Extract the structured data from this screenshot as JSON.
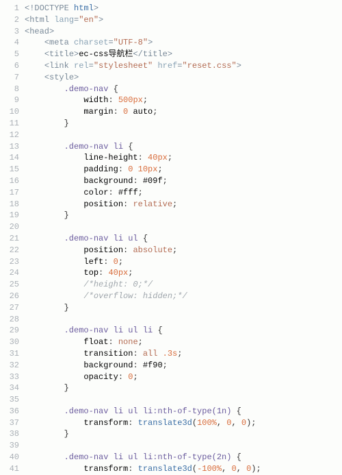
{
  "lines": [
    {
      "n": 1,
      "tokens": [
        [
          "doctype",
          "<!DOCTYPE "
        ],
        [
          "ident",
          "html"
        ],
        [
          "doctype",
          ">"
        ]
      ]
    },
    {
      "n": 2,
      "tokens": [
        [
          "punct",
          "<"
        ],
        [
          "tag",
          "html "
        ],
        [
          "attr",
          "lang"
        ],
        [
          "punct",
          "="
        ],
        [
          "str",
          "\"en\""
        ],
        [
          "punct",
          ">"
        ]
      ]
    },
    {
      "n": 3,
      "tokens": [
        [
          "punct",
          "<"
        ],
        [
          "tag",
          "head"
        ],
        [
          "punct",
          ">"
        ]
      ]
    },
    {
      "n": 4,
      "indent": "    ",
      "tokens": [
        [
          "punct",
          "<"
        ],
        [
          "tag",
          "meta "
        ],
        [
          "attr",
          "charset"
        ],
        [
          "punct",
          "="
        ],
        [
          "str",
          "\"UTF-8\""
        ],
        [
          "punct",
          ">"
        ]
      ]
    },
    {
      "n": 5,
      "indent": "    ",
      "tokens": [
        [
          "punct",
          "<"
        ],
        [
          "tag",
          "title"
        ],
        [
          "punct",
          ">"
        ],
        [
          "val",
          "ec-css导航栏"
        ],
        [
          "punct",
          "</"
        ],
        [
          "tag",
          "title"
        ],
        [
          "punct",
          ">"
        ]
      ]
    },
    {
      "n": 6,
      "indent": "    ",
      "tokens": [
        [
          "punct",
          "<"
        ],
        [
          "tag",
          "link "
        ],
        [
          "attr",
          "rel"
        ],
        [
          "punct",
          "="
        ],
        [
          "str",
          "\"stylesheet\""
        ],
        [
          "attr",
          " href"
        ],
        [
          "punct",
          "="
        ],
        [
          "str",
          "\"reset.css\""
        ],
        [
          "punct",
          ">"
        ]
      ]
    },
    {
      "n": 7,
      "indent": "    ",
      "tokens": [
        [
          "punct",
          "<"
        ],
        [
          "tag",
          "style"
        ],
        [
          "punct",
          ">"
        ]
      ]
    },
    {
      "n": 8,
      "indent": "        ",
      "tokens": [
        [
          "sel",
          ".demo-nav "
        ],
        [
          "brace",
          "{"
        ]
      ]
    },
    {
      "n": 9,
      "indent": "            ",
      "tokens": [
        [
          "prop",
          "width"
        ],
        [
          "semi",
          ": "
        ],
        [
          "num",
          "500px"
        ],
        [
          "semi",
          ";"
        ]
      ]
    },
    {
      "n": 10,
      "indent": "            ",
      "tokens": [
        [
          "prop",
          "margin"
        ],
        [
          "semi",
          ": "
        ],
        [
          "num",
          "0"
        ],
        [
          "val",
          " auto"
        ],
        [
          "semi",
          ";"
        ]
      ]
    },
    {
      "n": 11,
      "indent": "        ",
      "tokens": [
        [
          "brace",
          "}"
        ]
      ]
    },
    {
      "n": 12,
      "tokens": []
    },
    {
      "n": 13,
      "indent": "        ",
      "tokens": [
        [
          "sel",
          ".demo-nav li "
        ],
        [
          "brace",
          "{"
        ]
      ]
    },
    {
      "n": 14,
      "indent": "            ",
      "tokens": [
        [
          "prop",
          "line-height"
        ],
        [
          "semi",
          ": "
        ],
        [
          "num",
          "40px"
        ],
        [
          "semi",
          ";"
        ]
      ]
    },
    {
      "n": 15,
      "indent": "            ",
      "tokens": [
        [
          "prop",
          "padding"
        ],
        [
          "semi",
          ": "
        ],
        [
          "num",
          "0"
        ],
        [
          "val",
          " "
        ],
        [
          "num",
          "10px"
        ],
        [
          "semi",
          ";"
        ]
      ]
    },
    {
      "n": 16,
      "indent": "            ",
      "tokens": [
        [
          "prop",
          "background"
        ],
        [
          "semi",
          ": "
        ],
        [
          "val",
          "#09f"
        ],
        [
          "semi",
          ";"
        ]
      ]
    },
    {
      "n": 17,
      "indent": "            ",
      "tokens": [
        [
          "prop",
          "color"
        ],
        [
          "semi",
          ": "
        ],
        [
          "val",
          "#fff"
        ],
        [
          "semi",
          ";"
        ]
      ]
    },
    {
      "n": 18,
      "indent": "            ",
      "tokens": [
        [
          "prop",
          "position"
        ],
        [
          "semi",
          ": "
        ],
        [
          "kw",
          "relative"
        ],
        [
          "semi",
          ";"
        ]
      ]
    },
    {
      "n": 19,
      "indent": "        ",
      "tokens": [
        [
          "brace",
          "}"
        ]
      ]
    },
    {
      "n": 20,
      "tokens": []
    },
    {
      "n": 21,
      "indent": "        ",
      "tokens": [
        [
          "sel",
          ".demo-nav li ul "
        ],
        [
          "brace",
          "{"
        ]
      ]
    },
    {
      "n": 22,
      "indent": "            ",
      "tokens": [
        [
          "prop",
          "position"
        ],
        [
          "semi",
          ": "
        ],
        [
          "kw",
          "absolute"
        ],
        [
          "semi",
          ";"
        ]
      ]
    },
    {
      "n": 23,
      "indent": "            ",
      "tokens": [
        [
          "prop",
          "left"
        ],
        [
          "semi",
          ": "
        ],
        [
          "num",
          "0"
        ],
        [
          "semi",
          ";"
        ]
      ]
    },
    {
      "n": 24,
      "indent": "            ",
      "tokens": [
        [
          "prop",
          "top"
        ],
        [
          "semi",
          ": "
        ],
        [
          "num",
          "40px"
        ],
        [
          "semi",
          ";"
        ]
      ]
    },
    {
      "n": 25,
      "indent": "            ",
      "tokens": [
        [
          "comment",
          "/*height: 0;*/"
        ]
      ]
    },
    {
      "n": 26,
      "indent": "            ",
      "tokens": [
        [
          "comment",
          "/*overflow: hidden;*/"
        ]
      ]
    },
    {
      "n": 27,
      "indent": "        ",
      "tokens": [
        [
          "brace",
          "}"
        ]
      ]
    },
    {
      "n": 28,
      "tokens": []
    },
    {
      "n": 29,
      "indent": "        ",
      "tokens": [
        [
          "sel",
          ".demo-nav li ul li "
        ],
        [
          "brace",
          "{"
        ]
      ]
    },
    {
      "n": 30,
      "indent": "            ",
      "tokens": [
        [
          "prop",
          "float"
        ],
        [
          "semi",
          ": "
        ],
        [
          "kw",
          "none"
        ],
        [
          "semi",
          ";"
        ]
      ]
    },
    {
      "n": 31,
      "indent": "            ",
      "tokens": [
        [
          "prop",
          "transition"
        ],
        [
          "semi",
          ": "
        ],
        [
          "kw",
          "all"
        ],
        [
          "val",
          " "
        ],
        [
          "num",
          ".3s"
        ],
        [
          "semi",
          ";"
        ]
      ]
    },
    {
      "n": 32,
      "indent": "            ",
      "tokens": [
        [
          "prop",
          "background"
        ],
        [
          "semi",
          ": "
        ],
        [
          "val",
          "#f90"
        ],
        [
          "semi",
          ";"
        ]
      ]
    },
    {
      "n": 33,
      "indent": "            ",
      "tokens": [
        [
          "prop",
          "opacity"
        ],
        [
          "semi",
          ": "
        ],
        [
          "num",
          "0"
        ],
        [
          "semi",
          ";"
        ]
      ]
    },
    {
      "n": 34,
      "indent": "        ",
      "tokens": [
        [
          "brace",
          "}"
        ]
      ]
    },
    {
      "n": 35,
      "tokens": []
    },
    {
      "n": 36,
      "indent": "        ",
      "tokens": [
        [
          "sel",
          ".demo-nav li ul li:nth-of-type(1n) "
        ],
        [
          "brace",
          "{"
        ]
      ]
    },
    {
      "n": 37,
      "indent": "            ",
      "tokens": [
        [
          "prop",
          "transform"
        ],
        [
          "semi",
          ": "
        ],
        [
          "ident",
          "translate3d"
        ],
        [
          "brace",
          "("
        ],
        [
          "num",
          "100%"
        ],
        [
          "semi",
          ", "
        ],
        [
          "num",
          "0"
        ],
        [
          "semi",
          ", "
        ],
        [
          "num",
          "0"
        ],
        [
          "brace",
          ")"
        ],
        [
          "semi",
          ";"
        ]
      ]
    },
    {
      "n": 38,
      "indent": "        ",
      "tokens": [
        [
          "brace",
          "}"
        ]
      ]
    },
    {
      "n": 39,
      "tokens": []
    },
    {
      "n": 40,
      "indent": "        ",
      "tokens": [
        [
          "sel",
          ".demo-nav li ul li:nth-of-type(2n) "
        ],
        [
          "brace",
          "{"
        ]
      ]
    },
    {
      "n": 41,
      "indent": "            ",
      "tokens": [
        [
          "prop",
          "transform"
        ],
        [
          "semi",
          ": "
        ],
        [
          "ident",
          "translate3d"
        ],
        [
          "brace",
          "("
        ],
        [
          "num",
          "-100%"
        ],
        [
          "semi",
          ", "
        ],
        [
          "num",
          "0"
        ],
        [
          "semi",
          ", "
        ],
        [
          "num",
          "0"
        ],
        [
          "brace",
          ")"
        ],
        [
          "semi",
          ";"
        ]
      ]
    }
  ]
}
